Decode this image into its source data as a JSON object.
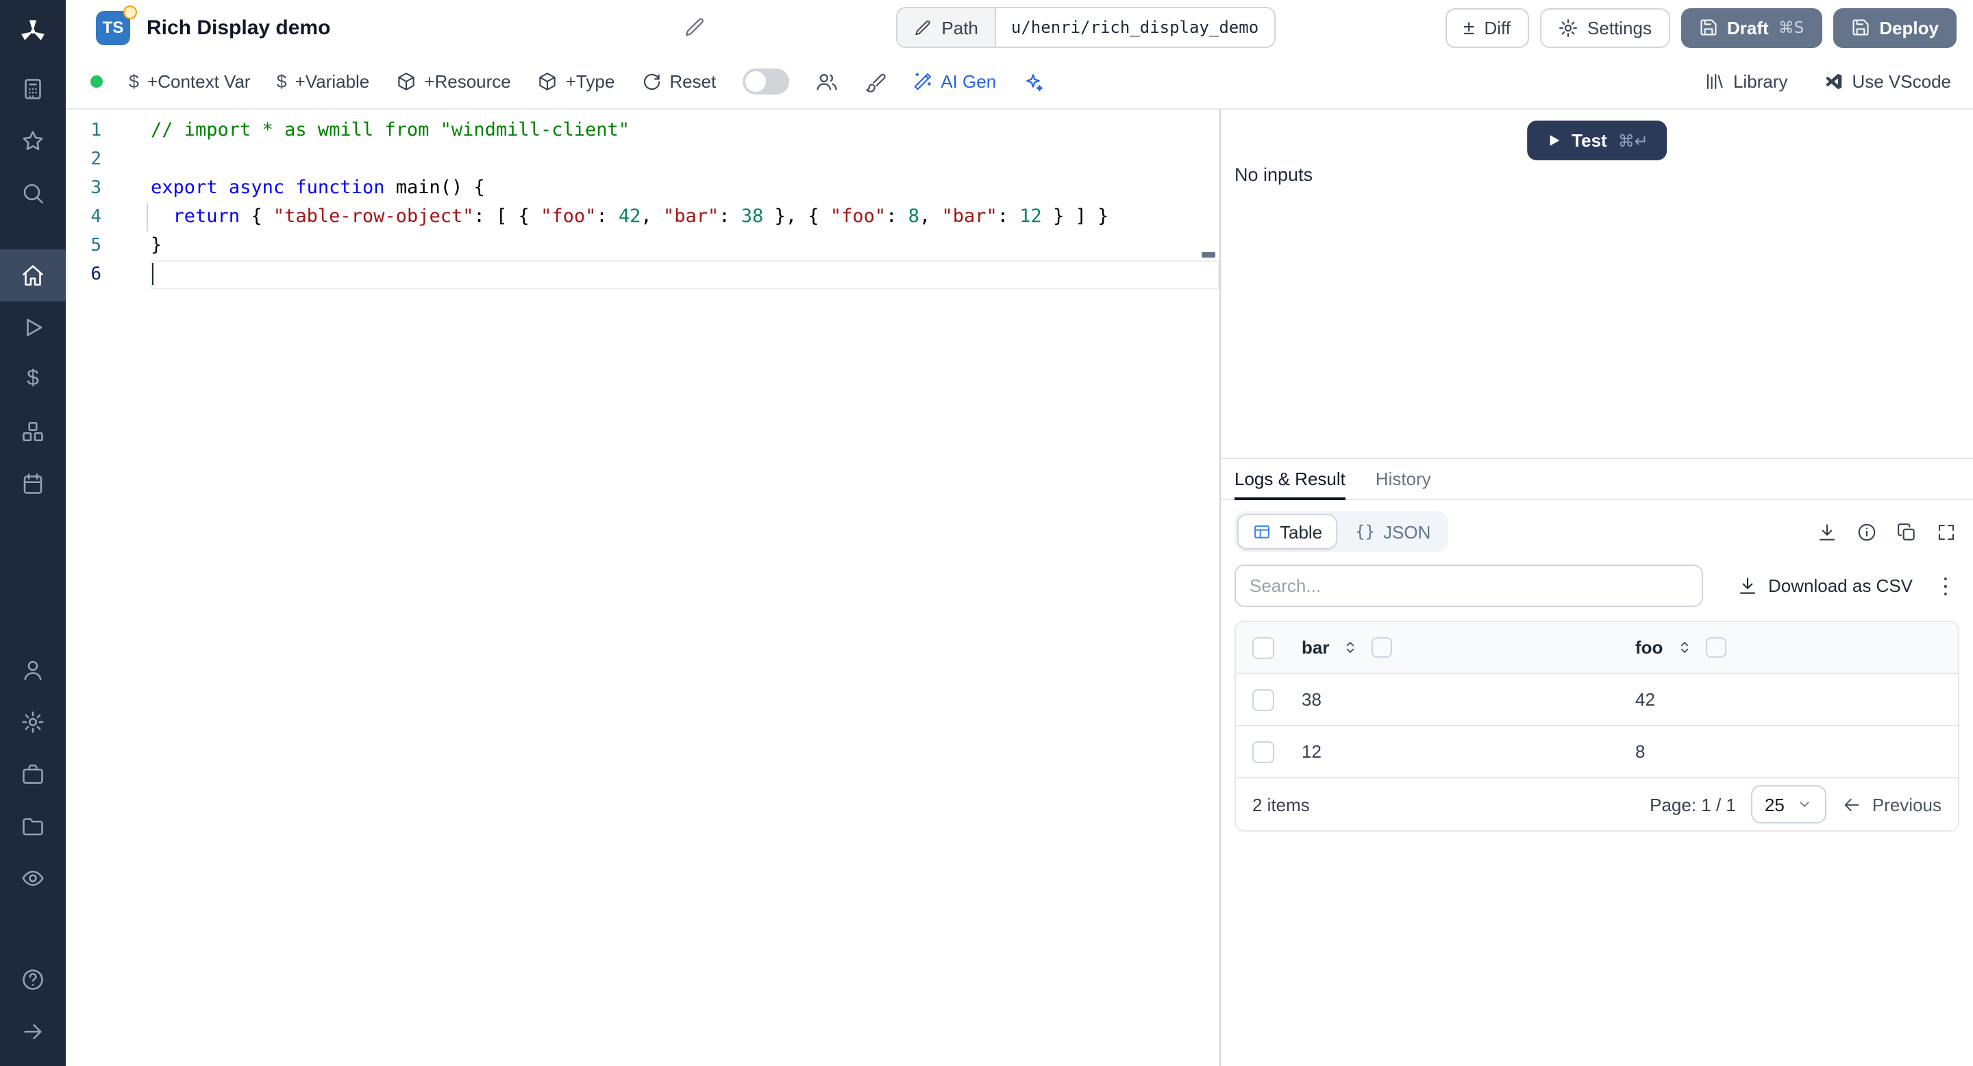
{
  "header": {
    "badge": "TS",
    "title": "Rich Display demo",
    "path": {
      "label": "Path",
      "value": "u/henri/rich_display_demo"
    },
    "buttons": {
      "diff": "Diff",
      "settings": "Settings",
      "draft": "Draft",
      "draft_shortcut": "⌘S",
      "deploy": "Deploy"
    }
  },
  "toolbar": {
    "context_var": "+Context Var",
    "variable": "+Variable",
    "resource": "+Resource",
    "type": "+Type",
    "reset": "Reset",
    "ai_gen": "AI Gen",
    "library": "Library",
    "use_vscode": "Use VScode"
  },
  "icons": {
    "dollar": "$",
    "plus_minus": "±",
    "vertical_dots": "⋮"
  },
  "editor": {
    "lines": [
      {
        "num": "1",
        "segs": [
          [
            "c",
            "// import * as wmill from \"windmill-client\""
          ]
        ]
      },
      {
        "num": "2",
        "segs": []
      },
      {
        "num": "3",
        "segs": [
          [
            "k",
            "export"
          ],
          [
            "p",
            " "
          ],
          [
            "k",
            "async"
          ],
          [
            "p",
            " "
          ],
          [
            "k",
            "function"
          ],
          [
            "p",
            " "
          ],
          [
            "i",
            "main"
          ],
          [
            "p",
            "() {"
          ]
        ]
      },
      {
        "num": "4",
        "guide": true,
        "segs": [
          [
            "p",
            "  "
          ],
          [
            "k",
            "return"
          ],
          [
            "p",
            " { "
          ],
          [
            "s",
            "\"table-row-object\""
          ],
          [
            "p",
            ": [ { "
          ],
          [
            "s",
            "\"foo\""
          ],
          [
            "p",
            ": "
          ],
          [
            "n",
            "42"
          ],
          [
            "p",
            ", "
          ],
          [
            "s",
            "\"bar\""
          ],
          [
            "p",
            ": "
          ],
          [
            "n",
            "38"
          ],
          [
            "p",
            " }, { "
          ],
          [
            "s",
            "\"foo\""
          ],
          [
            "p",
            ": "
          ],
          [
            "n",
            "8"
          ],
          [
            "p",
            ", "
          ],
          [
            "s",
            "\"bar\""
          ],
          [
            "p",
            ": "
          ],
          [
            "n",
            "12"
          ],
          [
            "p",
            " } ] }"
          ]
        ]
      },
      {
        "num": "5",
        "segs": [
          [
            "p",
            "}"
          ]
        ]
      },
      {
        "num": "6",
        "current": true,
        "cursor": true,
        "segs": []
      }
    ]
  },
  "run": {
    "test": "Test",
    "shortcut": "⌘↵",
    "no_inputs": "No inputs"
  },
  "result": {
    "tabs": {
      "logs": "Logs & Result",
      "history": "History"
    },
    "view": {
      "table": "Table",
      "json": "JSON",
      "json_icon": "{}"
    },
    "search_placeholder": "Search...",
    "download_csv": "Download as CSV",
    "table": {
      "columns": [
        "bar",
        "foo"
      ],
      "rows": [
        [
          "38",
          "42"
        ],
        [
          "12",
          "8"
        ]
      ],
      "items": "2 items",
      "page": "Page: 1 / 1",
      "page_size": "25",
      "previous": "Previous"
    }
  },
  "colors": {
    "sidebar_bg": "#1e293b",
    "brand_ts_blue": "#3178c6",
    "slate_button": "#64748b",
    "test_button": "#2c3a5a",
    "status_green": "#22c55e",
    "accent_blue": "#2563eb",
    "code_keyword": "#0000ff",
    "code_string": "#a31515",
    "code_number": "#098658",
    "code_comment": "#008000"
  }
}
